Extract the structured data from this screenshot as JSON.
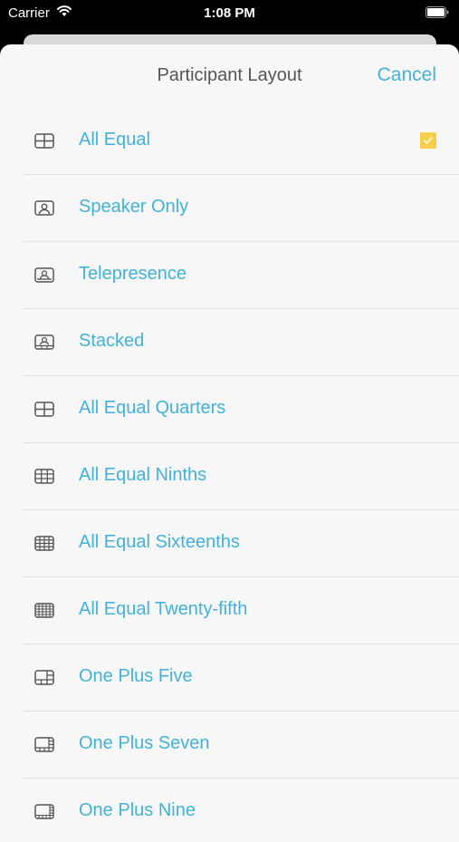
{
  "status_bar": {
    "carrier": "Carrier",
    "time": "1:08 PM",
    "icons": [
      "wifi-icon",
      "battery-icon"
    ]
  },
  "sheet": {
    "title": "Participant Layout",
    "cancel_label": "Cancel"
  },
  "colors": {
    "accent": "#41b3da",
    "check": "#f7cd4a",
    "title": "#555555",
    "background": "#f7f7f7"
  },
  "layouts": [
    {
      "label": "All Equal",
      "icon": "grid-2x2-icon",
      "selected": true
    },
    {
      "label": "Speaker Only",
      "icon": "speaker-only-icon",
      "selected": false
    },
    {
      "label": "Telepresence",
      "icon": "telepresence-icon",
      "selected": false
    },
    {
      "label": "Stacked",
      "icon": "stacked-icon",
      "selected": false
    },
    {
      "label": "All Equal Quarters",
      "icon": "grid-2x2-icon",
      "selected": false
    },
    {
      "label": "All Equal Ninths",
      "icon": "grid-3x3-icon",
      "selected": false
    },
    {
      "label": "All Equal Sixteenths",
      "icon": "grid-4x4-icon",
      "selected": false
    },
    {
      "label": "All Equal Twenty-fifth",
      "icon": "grid-5x5-icon",
      "selected": false
    },
    {
      "label": "One Plus Five",
      "icon": "one-plus-five-icon",
      "selected": false
    },
    {
      "label": "One Plus Seven",
      "icon": "one-plus-seven-icon",
      "selected": false
    },
    {
      "label": "One Plus Nine",
      "icon": "one-plus-nine-icon",
      "selected": false
    }
  ]
}
